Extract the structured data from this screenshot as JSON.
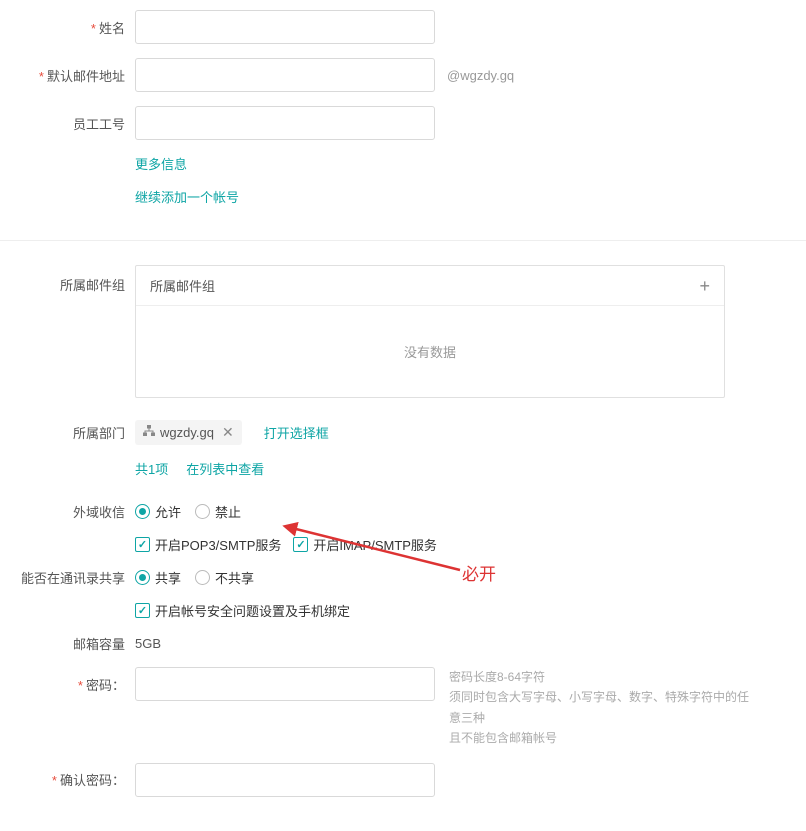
{
  "fields": {
    "name_label": "姓名",
    "email_label": "默认邮件地址",
    "email_suffix": "@wgzdy.gq",
    "emp_id_label": "员工工号",
    "more_info": "更多信息",
    "continue_add": "继续添加一个帐号",
    "mail_group_label": "所属邮件组",
    "mail_group_header": "所属邮件组",
    "mail_group_empty": "没有数据",
    "dept_label": "所属部门",
    "dept_tag": "wgzdy.gq",
    "open_selector": "打开选择框",
    "dept_count": "共1项",
    "view_in_list": "在列表中查看",
    "external_recv_label": "外域收信",
    "allow": "允许",
    "forbid": "禁止",
    "pop3_smtp": "开启POP3/SMTP服务",
    "imap_smtp": "开启IMAP/SMTP服务",
    "contacts_share_label": "能否在通讯录共享",
    "share": "共享",
    "not_share": "不共享",
    "security_bind": "开启帐号安全问题设置及手机绑定",
    "mailbox_cap_label": "邮箱容量",
    "mailbox_cap_value": "5GB",
    "password_label": "密码：",
    "confirm_password_label": "确认密码：",
    "password_hint1": "密码长度8-64字符",
    "password_hint2": "须同时包含大写字母、小写字母、数字、特殊字符中的任意三种",
    "password_hint3": "且不能包含邮箱帐号"
  },
  "annotation": {
    "must_open": "必开"
  }
}
